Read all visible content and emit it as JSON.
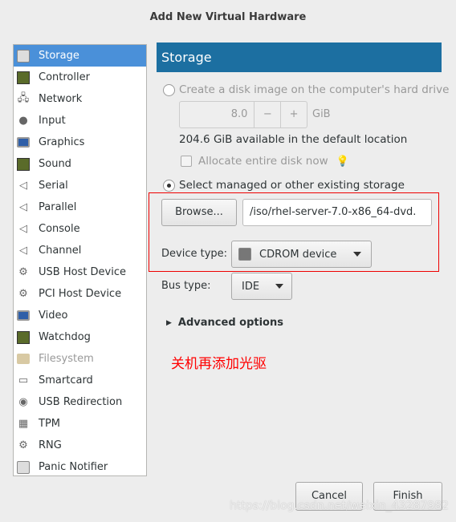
{
  "window": {
    "title": "Add New Virtual Hardware"
  },
  "sidebar": {
    "items": [
      {
        "label": "Storage",
        "icon": "disk-icon",
        "selected": true
      },
      {
        "label": "Controller",
        "icon": "card-icon"
      },
      {
        "label": "Network",
        "icon": "network-icon"
      },
      {
        "label": "Input",
        "icon": "mouse-icon"
      },
      {
        "label": "Graphics",
        "icon": "monitor-icon"
      },
      {
        "label": "Sound",
        "icon": "card-icon"
      },
      {
        "label": "Serial",
        "icon": "port-icon"
      },
      {
        "label": "Parallel",
        "icon": "port-icon"
      },
      {
        "label": "Console",
        "icon": "port-icon"
      },
      {
        "label": "Channel",
        "icon": "port-icon"
      },
      {
        "label": "USB Host Device",
        "icon": "gear-icon"
      },
      {
        "label": "PCI Host Device",
        "icon": "gear-icon"
      },
      {
        "label": "Video",
        "icon": "monitor-icon"
      },
      {
        "label": "Watchdog",
        "icon": "card-icon"
      },
      {
        "label": "Filesystem",
        "icon": "folder-icon",
        "disabled": true
      },
      {
        "label": "Smartcard",
        "icon": "smartcard-icon"
      },
      {
        "label": "USB Redirection",
        "icon": "usb-icon"
      },
      {
        "label": "TPM",
        "icon": "chip-icon"
      },
      {
        "label": "RNG",
        "icon": "gear-icon"
      },
      {
        "label": "Panic Notifier",
        "icon": "disk-icon"
      }
    ]
  },
  "main": {
    "header": "Storage",
    "create_disk_label": "Create a disk image on the computer's hard drive",
    "size_value": "8.0",
    "size_minus": "−",
    "size_plus": "+",
    "size_unit": "GiB",
    "available": "204.6 GiB available in the default location",
    "allocate_label": "Allocate entire disk now",
    "select_existing_label": "Select managed or other existing storage",
    "browse_label": "Browse...",
    "path_value": "/iso/rhel-server-7.0-x86_64-dvd.",
    "device_type_label": "Device type:",
    "device_type_value": "CDROM device",
    "bus_type_label": "Bus type:",
    "bus_type_value": "IDE",
    "advanced_label": "Advanced options",
    "annotation": "关机再添加光驱"
  },
  "footer": {
    "cancel": "Cancel",
    "finish": "Finish"
  },
  "watermark": "https://blog.csdn.net/weixin_43287982",
  "colors": {
    "accent": "#4a90d9",
    "header": "#1c6fa1",
    "annotation": "#ff0000"
  }
}
